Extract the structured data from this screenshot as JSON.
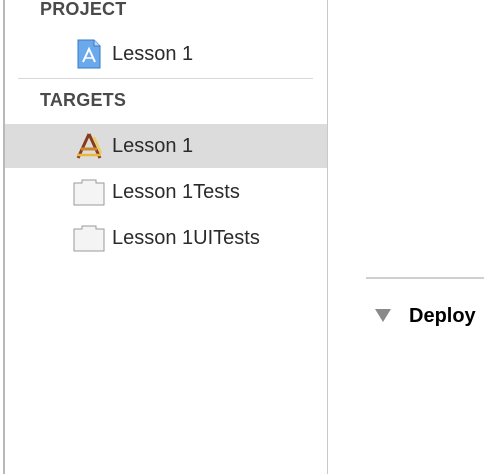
{
  "sidebar": {
    "project_header": "PROJECT",
    "project_item": {
      "label": "Lesson 1",
      "icon": "xcodeproj-icon"
    },
    "targets_header": "TARGETS",
    "targets": [
      {
        "label": "Lesson 1",
        "icon": "app-target-icon",
        "selected": true
      },
      {
        "label": "Lesson 1Tests",
        "icon": "test-bundle-icon",
        "selected": false
      },
      {
        "label": "Lesson 1UITests",
        "icon": "test-bundle-icon",
        "selected": false
      }
    ]
  },
  "main": {
    "section_title": "Deploy"
  },
  "colors": {
    "selection": "#dcdcdc",
    "header_text": "#4a4a4a",
    "project_icon_blue": "#4a90d9"
  }
}
